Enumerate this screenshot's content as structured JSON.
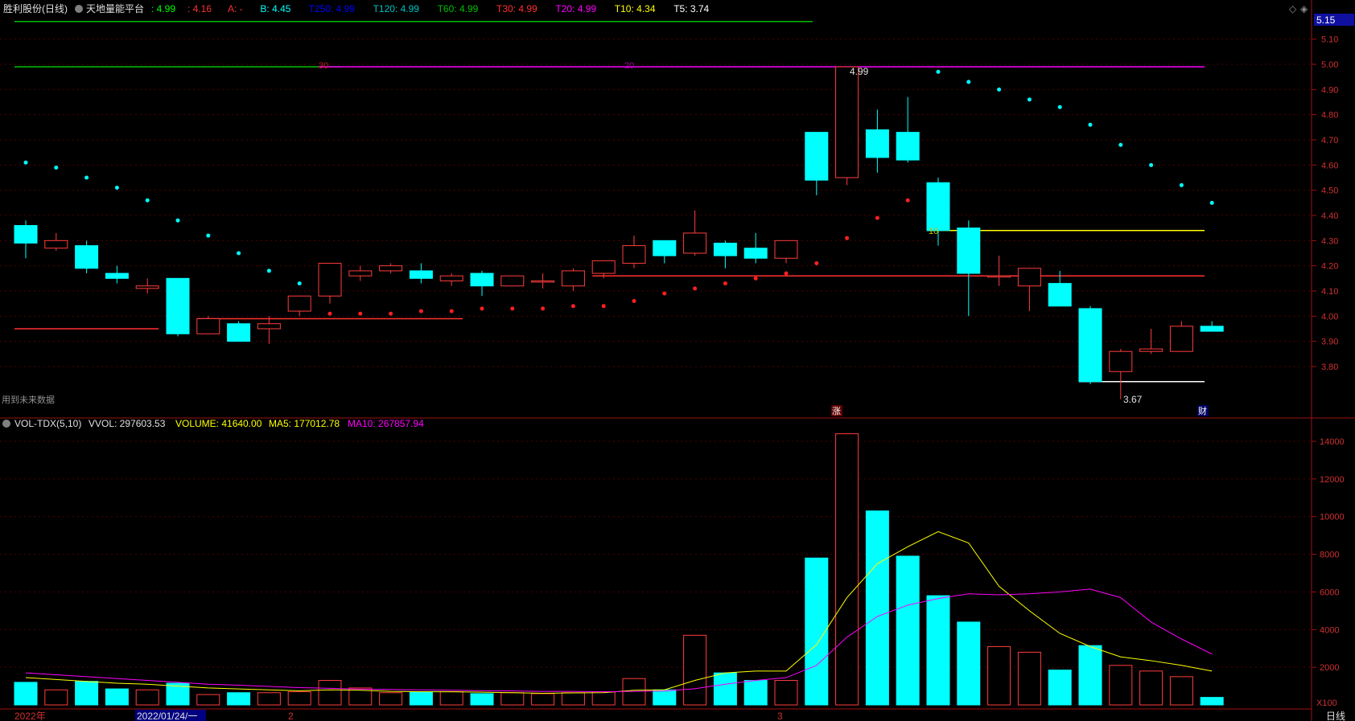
{
  "header": {
    "stock": "胜利股份(日线)",
    "indicator": "天地量能平台",
    "legend": [
      {
        "text": "4.99",
        "color": "#00ff00",
        "label": ":"
      },
      {
        "text": "A: -",
        "color": "#ff3030"
      },
      {
        "text": "B: 4.45",
        "color": "#00ffff"
      },
      {
        "text": "T250: 4.99",
        "color": "#0000ff"
      },
      {
        "text": "T120: 4.99",
        "color": "#00c0c0"
      },
      {
        "text": "T60: 4.99",
        "color": "#00c000"
      },
      {
        "text": "T30: 4.99",
        "color": "#ff3030"
      },
      {
        "text": "T20: 4.99",
        "color": "#ff00ff"
      },
      {
        "text": "T10: 4.34",
        "color": "#ffff00"
      },
      {
        "text": "T5: 3.74",
        "color": "#ffffff"
      }
    ],
    "legend_prefix": ": 4.99",
    "legend_sep": ": 4.16"
  },
  "vol_header": {
    "title": "VOL-TDX(5,10)",
    "vvol": "VVOL: 297603.53",
    "volume": "VOLUME: 41640.00",
    "ma5": "MA5: 177012.78",
    "ma10": "MA10: 267857.94"
  },
  "notes": {
    "future_data": "用到未来数据",
    "zhang": "涨",
    "cai": "财",
    "label_30": "30",
    "label_20": "20",
    "label_10": "10",
    "high_label": "4.99",
    "low_label": "3.67",
    "top_price": "5.15",
    "period": "日线",
    "x100": "X100"
  },
  "xaxis": {
    "labels": [
      "2022年",
      "2022/01/24/一",
      "2",
      "3"
    ]
  },
  "chart_data": [
    {
      "type": "candlestick",
      "ylim": [
        3.67,
        5.15
      ],
      "yticks": [
        3.8,
        3.9,
        4.0,
        4.1,
        4.2,
        4.3,
        4.4,
        4.5,
        4.6,
        4.7,
        4.8,
        4.9,
        5.0,
        5.1
      ],
      "candles": [
        {
          "o": 4.36,
          "c": 4.29,
          "h": 4.38,
          "l": 4.23
        },
        {
          "o": 4.27,
          "c": 4.3,
          "h": 4.33,
          "l": 4.26
        },
        {
          "o": 4.28,
          "c": 4.19,
          "h": 4.3,
          "l": 4.17
        },
        {
          "o": 4.17,
          "c": 4.15,
          "h": 4.2,
          "l": 4.13
        },
        {
          "o": 4.11,
          "c": 4.12,
          "h": 4.15,
          "l": 4.09
        },
        {
          "o": 4.15,
          "c": 3.93,
          "h": 4.15,
          "l": 3.92
        },
        {
          "o": 3.93,
          "c": 3.99,
          "h": 4.0,
          "l": 3.93
        },
        {
          "o": 3.97,
          "c": 3.9,
          "h": 3.98,
          "l": 3.9
        },
        {
          "o": 3.95,
          "c": 3.97,
          "h": 4.0,
          "l": 3.89
        },
        {
          "o": 4.02,
          "c": 4.08,
          "h": 4.08,
          "l": 4.0
        },
        {
          "o": 4.08,
          "c": 4.21,
          "h": 4.21,
          "l": 4.05
        },
        {
          "o": 4.16,
          "c": 4.18,
          "h": 4.2,
          "l": 4.14
        },
        {
          "o": 4.18,
          "c": 4.2,
          "h": 4.21,
          "l": 4.17
        },
        {
          "o": 4.18,
          "c": 4.15,
          "h": 4.21,
          "l": 4.13
        },
        {
          "o": 4.14,
          "c": 4.16,
          "h": 4.17,
          "l": 4.12
        },
        {
          "o": 4.17,
          "c": 4.12,
          "h": 4.18,
          "l": 4.08
        },
        {
          "o": 4.12,
          "c": 4.16,
          "h": 4.16,
          "l": 4.12
        },
        {
          "o": 4.14,
          "c": 4.14,
          "h": 4.17,
          "l": 4.11
        },
        {
          "o": 4.12,
          "c": 4.18,
          "h": 4.19,
          "l": 4.1
        },
        {
          "o": 4.17,
          "c": 4.22,
          "h": 4.22,
          "l": 4.15
        },
        {
          "o": 4.21,
          "c": 4.28,
          "h": 4.32,
          "l": 4.19
        },
        {
          "o": 4.3,
          "c": 4.24,
          "h": 4.3,
          "l": 4.21
        },
        {
          "o": 4.25,
          "c": 4.33,
          "h": 4.42,
          "l": 4.24
        },
        {
          "o": 4.29,
          "c": 4.24,
          "h": 4.3,
          "l": 4.19
        },
        {
          "o": 4.27,
          "c": 4.23,
          "h": 4.33,
          "l": 4.21
        },
        {
          "o": 4.23,
          "c": 4.3,
          "h": 4.3,
          "l": 4.21
        },
        {
          "o": 4.73,
          "c": 4.54,
          "h": 4.73,
          "l": 4.48
        },
        {
          "o": 4.55,
          "c": 4.99,
          "h": 4.99,
          "l": 4.52
        },
        {
          "o": 4.74,
          "c": 4.63,
          "h": 4.82,
          "l": 4.57
        },
        {
          "o": 4.73,
          "c": 4.62,
          "h": 4.87,
          "l": 4.61
        },
        {
          "o": 4.53,
          "c": 4.34,
          "h": 4.55,
          "l": 4.28
        },
        {
          "o": 4.35,
          "c": 4.17,
          "h": 4.38,
          "l": 4.0
        },
        {
          "o": 4.16,
          "c": 4.16,
          "h": 4.24,
          "l": 4.12
        },
        {
          "o": 4.12,
          "c": 4.19,
          "h": 4.19,
          "l": 4.02
        },
        {
          "o": 4.13,
          "c": 4.04,
          "h": 4.18,
          "l": 4.04
        },
        {
          "o": 4.03,
          "c": 3.74,
          "h": 4.04,
          "l": 3.73
        },
        {
          "o": 3.78,
          "c": 3.86,
          "h": 3.87,
          "l": 3.67
        },
        {
          "o": 3.86,
          "c": 3.87,
          "h": 3.95,
          "l": 3.85
        },
        {
          "o": 3.86,
          "c": 3.96,
          "h": 3.98,
          "l": 3.86
        },
        {
          "o": 3.96,
          "c": 3.94,
          "h": 3.98,
          "l": 3.94
        }
      ],
      "up_dots": [
        null,
        null,
        null,
        null,
        null,
        null,
        null,
        null,
        null,
        null,
        4.01,
        4.01,
        4.01,
        4.02,
        4.02,
        4.03,
        4.03,
        4.03,
        4.04,
        4.04,
        4.06,
        4.09,
        4.11,
        4.13,
        4.15,
        4.17,
        4.21,
        4.31,
        4.39,
        4.46,
        null,
        null,
        null,
        null,
        null,
        null,
        null,
        null,
        null,
        null
      ],
      "down_dots": [
        4.61,
        4.59,
        4.55,
        4.51,
        4.46,
        4.38,
        4.32,
        4.25,
        4.18,
        4.13,
        null,
        null,
        null,
        null,
        null,
        null,
        null,
        null,
        null,
        null,
        null,
        null,
        null,
        null,
        null,
        null,
        null,
        null,
        null,
        null,
        4.97,
        4.93,
        4.9,
        4.86,
        4.83,
        4.76,
        4.68,
        4.6,
        4.52,
        4.45
      ],
      "levels": [
        {
          "value": 5.17,
          "from": 0,
          "to": 25.5,
          "color": "#00c000"
        },
        {
          "value": 4.99,
          "from": 0,
          "to": 10,
          "color": "#00c000"
        },
        {
          "value": 4.99,
          "from": 10,
          "to": 39,
          "color": "#ff00ff"
        },
        {
          "value": 4.34,
          "from": 30,
          "to": 39,
          "color": "#ffff00"
        },
        {
          "value": 4.16,
          "from": 19,
          "to": 39,
          "color": "#ff3030"
        },
        {
          "value": 3.95,
          "from": 0,
          "to": 4,
          "color": "#ff3030"
        },
        {
          "value": 3.99,
          "from": 6,
          "to": 14,
          "color": "#ff3030"
        },
        {
          "value": 3.74,
          "from": 35,
          "to": 39,
          "color": "#ffffff"
        }
      ]
    },
    {
      "type": "bar",
      "ylim": [
        0,
        14500
      ],
      "yticks": [
        2000,
        4000,
        6000,
        8000,
        10000,
        12000,
        14000
      ],
      "volumes": [
        1200,
        800,
        1250,
        850,
        800,
        1150,
        550,
        650,
        650,
        700,
        1300,
        900,
        650,
        700,
        700,
        600,
        650,
        600,
        650,
        700,
        1400,
        800,
        3700,
        1700,
        1300,
        1300,
        7800,
        14400,
        10300,
        7900,
        5800,
        4400,
        3100,
        2800,
        1850,
        3150,
        2100,
        1800,
        1500,
        400
      ],
      "ma5": [
        1450,
        1350,
        1250,
        1150,
        1100,
        1000,
        900,
        850,
        800,
        750,
        800,
        780,
        720,
        700,
        700,
        680,
        650,
        620,
        640,
        650,
        780,
        800,
        1300,
        1700,
        1800,
        1800,
        3200,
        5700,
        7500,
        8400,
        9200,
        8600,
        6300,
        5000,
        3800,
        3100,
        2550,
        2350,
        2100,
        1800
      ],
      "ma10": [
        1700,
        1600,
        1500,
        1400,
        1300,
        1200,
        1100,
        1050,
        980,
        920,
        880,
        840,
        820,
        800,
        780,
        760,
        740,
        720,
        720,
        700,
        720,
        740,
        860,
        1100,
        1300,
        1450,
        2100,
        3600,
        4700,
        5300,
        5650,
        5900,
        5850,
        5900,
        6000,
        6150,
        5700,
        4400,
        3500,
        2700
      ]
    }
  ]
}
